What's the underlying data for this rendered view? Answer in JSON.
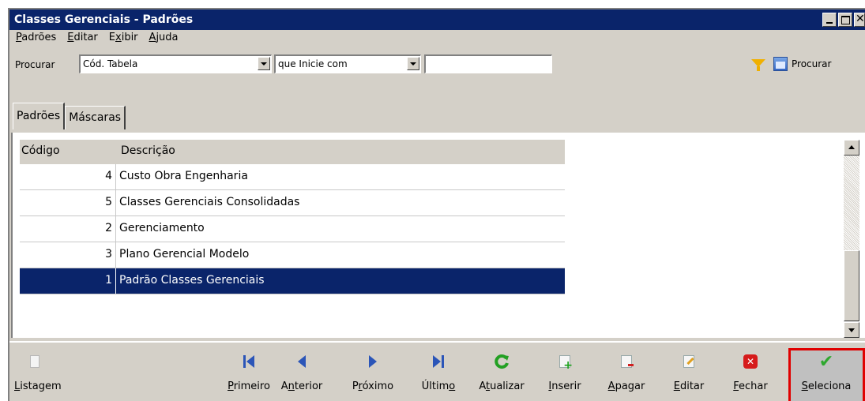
{
  "window": {
    "title": "Classes Gerenciais - Padrões"
  },
  "menu": [
    {
      "label": "Padrões",
      "accel": "P",
      "rest": "adrões"
    },
    {
      "label": "Editar",
      "accel": "E",
      "rest": "ditar"
    },
    {
      "label": "Exibir",
      "pre": "E",
      "accel": "x",
      "rest": "ibir"
    },
    {
      "label": "Ajuda",
      "accel": "A",
      "rest": "juda"
    }
  ],
  "search": {
    "label": "Procurar",
    "field_value": "Cód. Tabela",
    "operator_value": "que Inicie com",
    "text_value": "",
    "button_label": "Procurar"
  },
  "tabs": [
    {
      "label": "Padrões",
      "active": true
    },
    {
      "label": "Máscaras",
      "active": false
    }
  ],
  "table": {
    "headers": [
      "Código",
      "Descrição"
    ],
    "rows": [
      {
        "codigo": "4",
        "descricao": "Custo Obra Engenharia",
        "selected": false
      },
      {
        "codigo": "5",
        "descricao": "Classes Gerenciais Consolidadas",
        "selected": false
      },
      {
        "codigo": "2",
        "descricao": "Gerenciamento",
        "selected": false
      },
      {
        "codigo": "3",
        "descricao": "Plano Gerencial Modelo",
        "selected": false
      },
      {
        "codigo": "1",
        "descricao": "Padrão Classes Gerenciais",
        "selected": true
      }
    ]
  },
  "toolbar": {
    "listagem": {
      "pre": "",
      "accel": "L",
      "post": "istagem",
      "icon": "document-icon"
    },
    "primeiro": {
      "pre": "",
      "accel": "P",
      "post": "rimeiro",
      "icon": "first-record-icon"
    },
    "anterior": {
      "pre": "A",
      "accel": "n",
      "post": "terior",
      "icon": "previous-record-icon"
    },
    "proximo": {
      "pre": "P",
      "accel": "r",
      "post": "óximo",
      "icon": "next-record-icon"
    },
    "ultimo": {
      "pre": "Últim",
      "accel": "o",
      "post": "",
      "icon": "last-record-icon"
    },
    "atualizar": {
      "pre": "A",
      "accel": "t",
      "post": "ualizar",
      "icon": "refresh-icon"
    },
    "inserir": {
      "pre": "",
      "accel": "I",
      "post": "nserir",
      "icon": "insert-icon"
    },
    "apagar": {
      "pre": "",
      "accel": "A",
      "post": "pagar",
      "icon": "delete-icon"
    },
    "editar": {
      "pre": "",
      "accel": "E",
      "post": "ditar",
      "icon": "edit-icon"
    },
    "fechar": {
      "pre": "",
      "accel": "F",
      "post": "echar",
      "icon": "close-icon"
    },
    "seleciona": {
      "pre": "",
      "accel": "S",
      "post": "eleciona",
      "icon": "check-icon",
      "highlight_color": "#e00000"
    }
  },
  "colors": {
    "titlebar": "#0a246a",
    "selection": "#0a246a",
    "face": "#d4d0c8"
  }
}
